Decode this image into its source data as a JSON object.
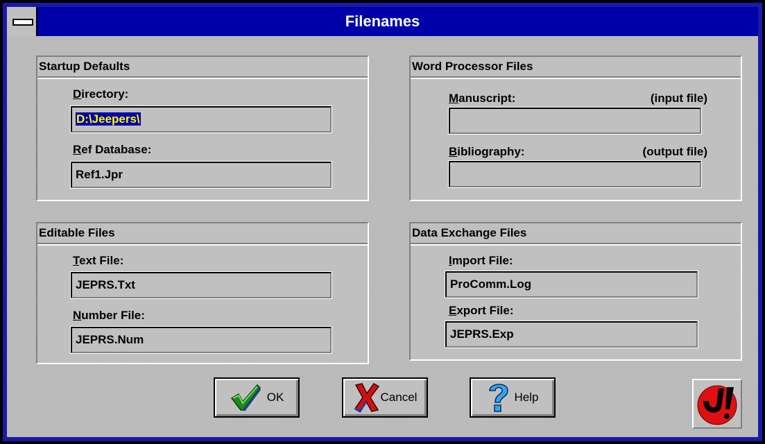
{
  "window": {
    "title": "Filenames"
  },
  "startup_defaults": {
    "header": "Startup Defaults",
    "directory": {
      "label": "Directory:",
      "value": "D:\\Jeepers\\"
    },
    "ref_database": {
      "label": "Ref Database:",
      "value": "Ref1.Jpr"
    }
  },
  "word_processor": {
    "header": "Word Processor Files",
    "manuscript": {
      "label": "Manuscript:",
      "hint": "(input file)",
      "value": ""
    },
    "bibliography": {
      "label": "Bibliography:",
      "hint": "(output file)",
      "value": ""
    }
  },
  "editable_files": {
    "header": "Editable Files",
    "text_file": {
      "label": "Text File:",
      "value": "JEPRS.Txt"
    },
    "number_file": {
      "label": "Number File:",
      "value": "JEPRS.Num"
    }
  },
  "data_exchange": {
    "header": "Data Exchange Files",
    "import_file": {
      "label": "Import File:",
      "value": "ProComm.Log"
    },
    "export_file": {
      "label": "Export File:",
      "value": "JEPRS.Exp"
    }
  },
  "buttons": {
    "ok": "OK",
    "cancel": "Cancel",
    "help": "Help"
  },
  "icons": {
    "system_menu": "system-menu-icon",
    "ok": "checkmark-icon",
    "cancel": "x-icon",
    "help": "question-mark-icon",
    "logo": "jeepers-logo-icon"
  },
  "colors": {
    "titlebar": "#0000a8",
    "selection_bg": "#0000a8",
    "selection_fg": "#ffff00",
    "face": "#c0c0c0"
  }
}
